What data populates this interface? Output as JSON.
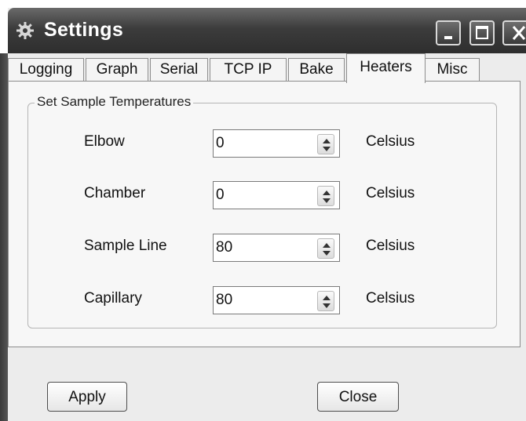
{
  "window": {
    "title": "Settings",
    "title_icon": "gear-icon",
    "controls": [
      "minimize-icon",
      "maximize-icon",
      "close-icon"
    ]
  },
  "tabs": [
    {
      "label": "Logging",
      "active": false
    },
    {
      "label": "Graph",
      "active": false
    },
    {
      "label": "Serial",
      "active": false
    },
    {
      "label": "TCP IP",
      "active": false
    },
    {
      "label": "Bake",
      "active": false
    },
    {
      "label": "Heaters",
      "active": true
    },
    {
      "label": "Misc",
      "active": false
    }
  ],
  "group": {
    "title": "Set Sample Temperatures",
    "rows": [
      {
        "label": "Elbow",
        "value": "0",
        "unit": "Celsius"
      },
      {
        "label": "Chamber",
        "value": "0",
        "unit": "Celsius"
      },
      {
        "label": "Sample Line",
        "value": "80",
        "unit": "Celsius"
      },
      {
        "label": "Capillary",
        "value": "80",
        "unit": "Celsius"
      }
    ]
  },
  "buttons": {
    "apply": "Apply",
    "close": "Close"
  },
  "colors": {
    "titlebar": "#3c3c3c",
    "panel": "#f7f7f7",
    "background": "#ececec"
  }
}
